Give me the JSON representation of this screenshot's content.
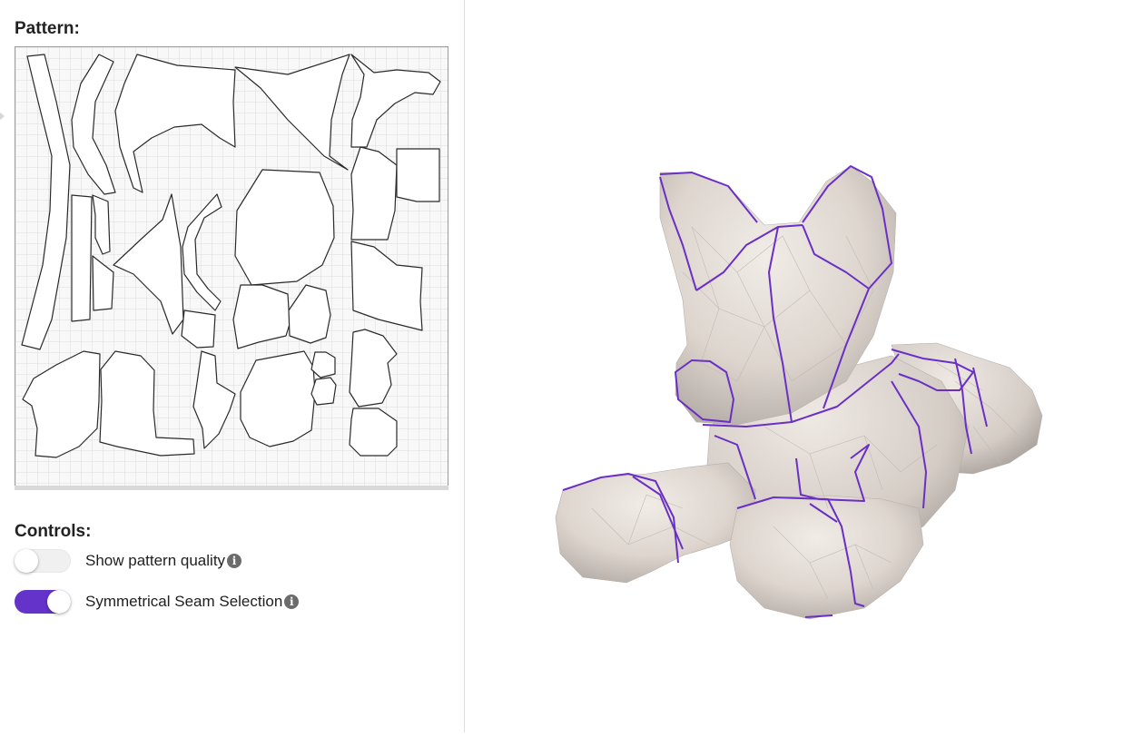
{
  "pattern": {
    "title": "Pattern:"
  },
  "controls": {
    "title": "Controls:",
    "show_pattern_quality": {
      "label": "Show pattern quality",
      "enabled": false,
      "info_icon": "info-icon"
    },
    "symmetrical_seam_selection": {
      "label": "Symmetrical Seam Selection",
      "enabled": true,
      "info_icon": "info-icon"
    }
  },
  "colors": {
    "accent": "#6433c9",
    "seam": "#6a2fc4",
    "mesh_fill": "#dbd3cc",
    "grid": "#dcdcdc"
  },
  "viewer": {
    "model": "plush-cat-3d-model"
  }
}
